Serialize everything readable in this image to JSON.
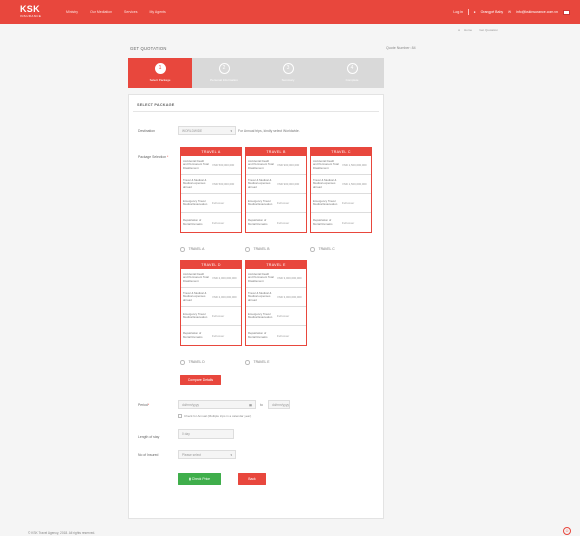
{
  "brand": {
    "name": "KSK",
    "tag": "INSURANCE"
  },
  "nav": [
    "Ministry",
    "Our Mediation",
    "Services",
    "My Agents"
  ],
  "topright": {
    "login": "Log in",
    "user": "Orangpé Baby",
    "email": "info@kskinsurance.com.vn"
  },
  "breadcrumb": [
    "Home",
    "Get Quotation"
  ],
  "page": {
    "title": "GET QUOTATION",
    "quote_no": "Quote Number: 84"
  },
  "steps": [
    {
      "num": "1",
      "label": "Select Package"
    },
    {
      "num": "2",
      "label": "Personal Information"
    },
    {
      "num": "3",
      "label": "Summary"
    },
    {
      "num": "4",
      "label": "Complete"
    }
  ],
  "form": {
    "section_title": "SELECT PACKAGE",
    "destination_label": "Destination",
    "destination_value": "WORLDWIDE",
    "destination_hint": "For Annual trips, kindly select Worldwide.",
    "package_label": "Package Selection",
    "period_label": "Period",
    "period_from": "dd/mm/yyyy",
    "period_to_word": "to",
    "period_to": "dd/mm/yyyy",
    "annual_check": "Check for Annual (Multiple trips in a calendar year)",
    "length_label": "Length of stay",
    "length_value": "0 day",
    "insured_label": "No of Insured",
    "insured_value": "Please select",
    "compare_btn": "Compare Details",
    "check_price_btn": "Check Price",
    "back_btn": "Back"
  },
  "packages": [
    {
      "name": "TRAVEL A",
      "radio": "TRAVEL A",
      "rows": [
        {
          "label": "Accidental Death and Permanent Total Disablement",
          "value": "VND 500,000,000"
        },
        {
          "label": "Travel & Medical & Medical expenses abroad",
          "value": "VND 500,000,000"
        },
        {
          "label": "Emergency Travel Medical Evacuation",
          "value": "Full cover"
        },
        {
          "label": "Repatriation of Mortal Remains",
          "value": "Full cover"
        }
      ]
    },
    {
      "name": "TRAVEL B",
      "radio": "TRAVEL B",
      "rows": [
        {
          "label": "Accidental Death and Permanent Total Disablement",
          "value": "VND 900,000,000"
        },
        {
          "label": "Travel & Medical & Medical expenses abroad",
          "value": "VND 900,000,000"
        },
        {
          "label": "Emergency Travel Medical Evacuation",
          "value": "Full cover"
        },
        {
          "label": "Repatriation of Mortal Remains",
          "value": "Full cover"
        }
      ]
    },
    {
      "name": "TRAVEL C",
      "radio": "TRAVEL C",
      "rows": [
        {
          "label": "Accidental Death and Permanent Total Disablement",
          "value": "VND 1,500,000,000"
        },
        {
          "label": "Travel & Medical & Medical expenses abroad",
          "value": "VND 1,500,000,000"
        },
        {
          "label": "Emergency Travel Medical Evacuation",
          "value": "Full cover"
        },
        {
          "label": "Repatriation of Mortal Remains",
          "value": "Full cover"
        }
      ]
    },
    {
      "name": "TRAVEL D",
      "radio": "TRAVEL D",
      "rows": [
        {
          "label": "Accidental Death and Permanent Total Disablement",
          "value": "VND 2,000,000,000"
        },
        {
          "label": "Travel & Medical & Medical expenses abroad",
          "value": "VND 2,000,000,000"
        },
        {
          "label": "Emergency Travel Medical Evacuation",
          "value": "Full cover"
        },
        {
          "label": "Repatriation of Mortal Remains",
          "value": "Full cover"
        }
      ]
    },
    {
      "name": "TRAVEL E",
      "radio": "TRAVEL E",
      "rows": [
        {
          "label": "Accidental Death and Permanent Total Disablement",
          "value": "VND 3,000,000,000"
        },
        {
          "label": "Travel & Medical & Medical expenses abroad",
          "value": "VND 3,000,000,000"
        },
        {
          "label": "Emergency Travel Medical Evacuation",
          "value": "Full cover"
        },
        {
          "label": "Repatriation of Mortal Remains",
          "value": "Full cover"
        }
      ]
    }
  ],
  "footer": "© KSK Travel Agency, 2018. All rights reserved.",
  "colors": {
    "brand": "#e8473d",
    "success": "#3fae4b"
  }
}
